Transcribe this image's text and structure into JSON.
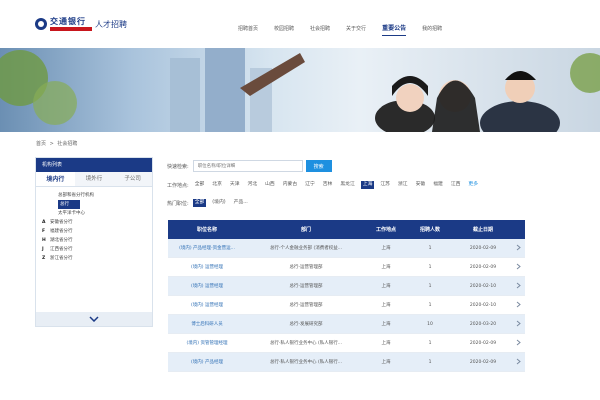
{
  "brand": {
    "name": "交通银行",
    "product": "人才招聘",
    "brand_color": "#1b3a86",
    "accent_red": "#c8161d"
  },
  "nav": {
    "items": [
      "招聘首页",
      "校园招聘",
      "社会招聘",
      "关于交行",
      "重要公告",
      "我的招聘"
    ],
    "active_index": 4
  },
  "breadcrumb": {
    "home": "首页",
    "separator": ">",
    "current": "社会招聘"
  },
  "sidebar": {
    "title": "机构列表",
    "tabs": [
      "境内行",
      "境外行",
      "子公司"
    ],
    "active_tab": 0,
    "items": [
      {
        "key": "",
        "label": "总部和省分行机构",
        "selected": false
      },
      {
        "key": "",
        "label": "总行",
        "selected": true
      },
      {
        "key": "",
        "label": "太平洋卡中心",
        "selected": false
      },
      {
        "key": "A",
        "label": "安徽省分行",
        "selected": false
      },
      {
        "key": "F",
        "label": "福建省分行",
        "selected": false
      },
      {
        "key": "H",
        "label": "湖北省分行",
        "selected": false
      },
      {
        "key": "J",
        "label": "江西省分行",
        "selected": false
      },
      {
        "key": "Z",
        "label": "浙江省分行",
        "selected": false
      }
    ],
    "toggle_icon": "chevron-down-icon"
  },
  "filters": {
    "search_label": "快速检索:",
    "search_placeholder": "职位名称/职位详细",
    "search_button": "搜索",
    "location_label": "工作地点:",
    "locations": [
      "全部",
      "北京",
      "天津",
      "河北",
      "山西",
      "内蒙古",
      "辽宁",
      "吉林",
      "黑龙江",
      "上海",
      "江苏",
      "浙江",
      "安徽",
      "福建",
      "江西",
      "更多"
    ],
    "location_active": 9,
    "hot_label": "热门职位:",
    "hot_items": [
      "全部",
      "(境内)",
      "产品..."
    ],
    "hot_active": 0
  },
  "table": {
    "headers": [
      "职位名称",
      "部门",
      "工作地点",
      "招聘人数",
      "截止日期"
    ],
    "rows": [
      [
        "(境内) 产品经理-资金营运...",
        "总行-个人金融业务部 (消费者权益...",
        "上海",
        "1",
        "2020-02-09"
      ],
      [
        "(境内) 运营经理",
        "总行-运营管理部",
        "上海",
        "1",
        "2020-02-09"
      ],
      [
        "(境内) 运营经理",
        "总行-运营管理部",
        "上海",
        "1",
        "2020-02-10"
      ],
      [
        "(境内) 运营经理",
        "总行-运营管理部",
        "上海",
        "1",
        "2020-02-10"
      ],
      [
        "博士后科研人员",
        "总行-发展研究部",
        "上海",
        "10",
        "2020-03-20"
      ],
      [
        "(境内) 资管管理经理",
        "总行-私人银行业务中心 (私人银行...",
        "上海",
        "1",
        "2020-02-09"
      ],
      [
        "(境内) 产品经理",
        "总行-私人银行业务中心 (私人银行...",
        "上海",
        "1",
        "2020-02-09"
      ]
    ],
    "row_icon": "chevron-right-icon"
  }
}
